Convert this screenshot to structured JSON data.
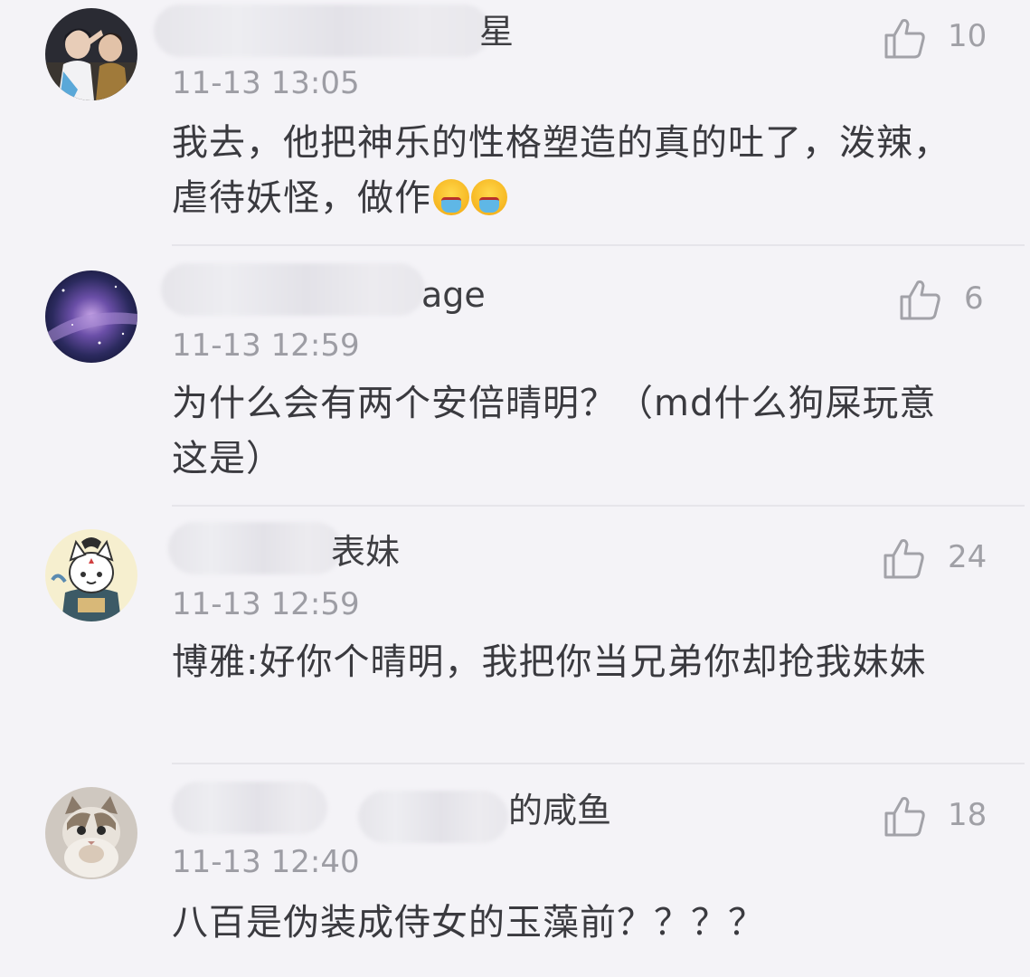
{
  "comments": [
    {
      "username_visible": "星",
      "time": "11-13 13:05",
      "likes": "10",
      "text": "我去，他把神乐的性格塑造的真的吐了，泼辣，虐待妖怪，做作",
      "avatar_icon": "avatar-anime-couple",
      "emoji_count": 2,
      "emoji_icon": "vomit-emoji"
    },
    {
      "username_visible": "age",
      "time": "11-13 12:59",
      "likes": "6",
      "text": "为什么会有两个安倍晴明？（md什么狗屎玩意这是）",
      "avatar_icon": "avatar-galaxy"
    },
    {
      "username_visible": "表妹",
      "time": "11-13 12:59",
      "likes": "24",
      "text": "博雅:好你个晴明，我把你当兄弟你却抢我妹妹",
      "avatar_icon": "avatar-cartoon-character"
    },
    {
      "username_visible": "的咸鱼",
      "time": "11-13 12:40",
      "likes": "18",
      "text": "八百是伪装成侍女的玉藻前？？？？",
      "avatar_icon": "avatar-cat"
    }
  ],
  "icons": {
    "like": "thumbs-up-icon"
  }
}
